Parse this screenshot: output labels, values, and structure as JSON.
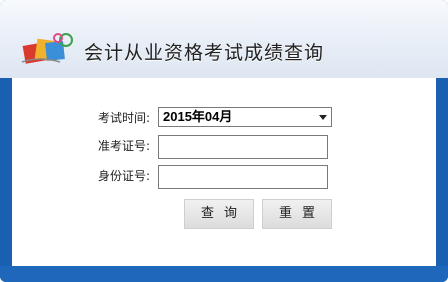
{
  "header": {
    "title": "会计从业资格考试成绩查询",
    "logo_icon": "books-icon"
  },
  "form": {
    "exam_time": {
      "label": "考试时间:",
      "selected": "2015年04月"
    },
    "admission_no": {
      "label": "准考证号:",
      "value": ""
    },
    "id_no": {
      "label": "身份证号:",
      "value": ""
    },
    "buttons": {
      "query_label": "查询",
      "reset_label": "重置"
    }
  },
  "colors": {
    "frame_blue": "#1a5fb0",
    "header_bg": "#e8eef7"
  }
}
